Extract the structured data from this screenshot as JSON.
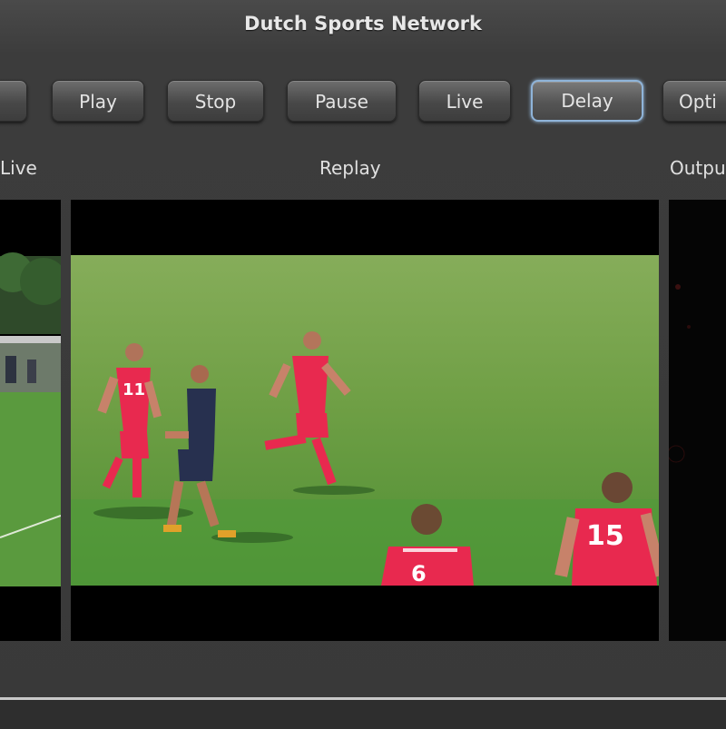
{
  "window": {
    "title": "Dutch Sports Network"
  },
  "toolbar": {
    "buttons": [
      {
        "label": ""
      },
      {
        "label": "Play"
      },
      {
        "label": "Stop"
      },
      {
        "label": "Pause"
      },
      {
        "label": "Live"
      },
      {
        "label": "Delay",
        "active": true
      },
      {
        "label": "Opti"
      }
    ]
  },
  "panels": {
    "live_label": "Live",
    "replay_label": "Replay",
    "output_label": "Outpu"
  },
  "replay": {
    "jersey_numbers": [
      "11",
      "6",
      "15"
    ]
  },
  "colors": {
    "accent": "#8fb4d9",
    "pitch": "#5f9a3c",
    "home_kit": "#e8294f",
    "away_kit": "#27304f"
  }
}
